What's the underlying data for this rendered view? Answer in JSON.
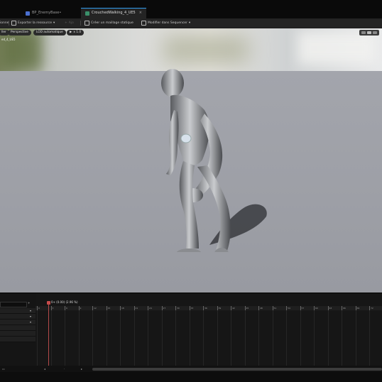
{
  "tabs": [
    {
      "label": "BP_EnemyBase•",
      "active": false
    },
    {
      "label": "CrouchedWalking_4_UE5",
      "active": true,
      "close": "×"
    }
  ],
  "toolbar": {
    "first_label": "ionne",
    "export_label": "Exporter la ressource",
    "export_caret": "▾",
    "add_label": "Ajo",
    "static_mesh_label": "Créer un maillage statique",
    "sequencer_label": "Modifier dans Sequencer",
    "sequencer_caret": "▾"
  },
  "viewport": {
    "buttons": [
      "ller",
      "Perspective",
      "LOD automatique",
      "x 1.0"
    ],
    "label": "ed_4_UE5",
    "colors": {
      "floor": "#a0a2a9",
      "sky": "#d9dad8"
    }
  },
  "sequencer": {
    "frame_label": "0+ (0.00) (2.96 %)",
    "ticks": [
      "0",
      "3",
      "6",
      "9",
      "12",
      "15",
      "18",
      "21",
      "24",
      "27",
      "30",
      "33",
      "36",
      "39",
      "42",
      "45",
      "48",
      "51",
      "54",
      "57",
      "60",
      "63",
      "66",
      "69",
      "72"
    ],
    "dropdown_caret": "▾",
    "add_button": "+"
  }
}
